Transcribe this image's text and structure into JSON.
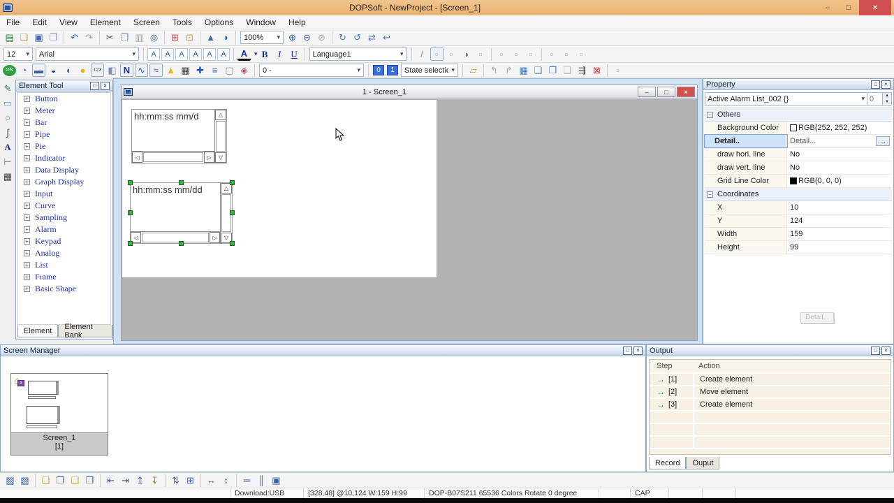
{
  "colors": {
    "titlebar": "#eab271",
    "close_button": "#d24f4f",
    "selection_handle": "#3cb043",
    "highlight_row": "#cfe3f8",
    "mdi_background": "#cfe0f0",
    "canvas_gray": "#b2b2b2",
    "bg_color_swatch": "#fcfcfc",
    "grid_line_swatch": "#000000"
  },
  "titlebar": {
    "title": "DOPSoft - NewProject - [Screen_1]"
  },
  "menu": {
    "items": [
      "File",
      "Edit",
      "View",
      "Element",
      "Screen",
      "Tools",
      "Options",
      "Window",
      "Help"
    ]
  },
  "toolbar1": {
    "zoom_value": "100%"
  },
  "toolbar2": {
    "font_size": "12",
    "font_name": "Arial",
    "language": "Language1",
    "bold": "B",
    "italic": "I",
    "underline": "U"
  },
  "toolbar3": {
    "address": "0 -",
    "state_off": "0",
    "state_on": "1",
    "state_select": "State selectio"
  },
  "element_tool": {
    "title": "Element Tool",
    "items": [
      "Button",
      "Meter",
      "Bar",
      "Pipe",
      "Pie",
      "Indicator",
      "Data Display",
      "Graph Display",
      "Input",
      "Curve",
      "Sampling",
      "Alarm",
      "Keypad",
      "Analog",
      "List",
      "Frame",
      "Basic Shape"
    ],
    "tab_element": "Element",
    "tab_element_bank": "Element Bank"
  },
  "canvas": {
    "window_title": "1 - Screen_1",
    "alarm_text_1": "hh:mm:ss  mm/d",
    "alarm_text_2": "hh:mm:ss  mm/dd"
  },
  "property": {
    "title": "Property",
    "element_selector": "Active Alarm List_002 {}",
    "spinner_value": "0",
    "section_others": "Others",
    "bg_color_label": "Background Color",
    "bg_color_value": "RGB(252, 252, 252)",
    "detail_label": "Detail..",
    "detail_value": "Detail...",
    "detail_more": "...",
    "hori_label": "draw hori. line",
    "hori_value": "No",
    "vert_label": "draw vert. line",
    "vert_value": "No",
    "grid_color_label": "Grid Line Color",
    "grid_color_value": "RGB(0, 0, 0)",
    "section_coordinates": "Coordinates",
    "x_label": "X",
    "x_value": "10",
    "y_label": "Y",
    "y_value": "124",
    "width_label": "Width",
    "width_value": "159",
    "height_label": "Height",
    "height_value": "99",
    "detail_button": "Detail..."
  },
  "screen_manager": {
    "title": "Screen Manager",
    "screen_name": "Screen_1",
    "screen_index": "[1]"
  },
  "output": {
    "title": "Output",
    "col_step": "Step",
    "col_action": "Action",
    "rows": [
      {
        "step": "[1]",
        "action": "Create element"
      },
      {
        "step": "[2]",
        "action": "Move element"
      },
      {
        "step": "[3]",
        "action": "Create element"
      }
    ],
    "tab_record": "Record",
    "tab_output": "Ouput"
  },
  "statusbar": {
    "download": "Download:USB",
    "coords": "[328,48] @10,124 W:159 H:99",
    "device": "DOP-B07S211 65536 Colors Rotate 0 degree",
    "caps": "CAP"
  },
  "icons": {
    "min": "–",
    "max": "□",
    "close": "×",
    "pmax": "□",
    "pclose": "×",
    "dd": "▾",
    "spin_up": "▲",
    "spin_dn": "▼",
    "plus": "+",
    "minus": "−",
    "s_up": "△",
    "s_dn": "▽",
    "s_lt": "◁",
    "s_rt": "▷",
    "home": "⌂",
    "home_n": "1",
    "step_arrow": "→",
    "new": "▤",
    "open": "❏",
    "save": "▣",
    "saveall": "❐",
    "undo": "↶",
    "redo": "↷",
    "cut": "✂",
    "copy": "❐",
    "paste": "▥",
    "find": "◎",
    "addscr": "⊞",
    "openscr": "⊡",
    "upload": "▲",
    "contrast": "◑",
    "zin": "⊕",
    "zout": "⊖",
    "znone": "⊘",
    "rotcw": "↻",
    "rotccw": "↺",
    "trans": "⇄",
    "undorot": "↩",
    "a": "A",
    "slash": "/",
    "box": "▫",
    "on": "ON",
    "meter": "◔",
    "bar": "▬",
    "tank": "◒",
    "half": "◖",
    "pie": "●",
    "numd": "123",
    "ind": "◧",
    "numi": "N",
    "curve": "∿",
    "graph": "≈",
    "keypad2": "▲",
    "kb": "▦",
    "pipe": "✚",
    "list": "≡",
    "frame": "▢",
    "shape": "◈",
    "macro": "▱",
    "prev": "↰",
    "next": "↱",
    "multi": "▦",
    "scr1": "❏",
    "scr2": "❐",
    "scr3": "❑",
    "build": "⇶",
    "dl": "⊠",
    "pencil": "✎",
    "rect": "▭",
    "ellipse": "○",
    "bezier": "∫",
    "textA": "A",
    "scale": "⊢",
    "table": "▦",
    "b1": "▧",
    "b2": "▨",
    "b3": "❏",
    "b4": "❐",
    "b5": "❑",
    "b6": "❒",
    "b7": "⇤",
    "b8": "⇥",
    "b9": "↥",
    "b10": "↧",
    "b11": "⇅",
    "b12": "⊞",
    "b13": "⊟",
    "b14": "↔",
    "b15": "↕",
    "b16": "═",
    "b17": "║",
    "b18": "▣"
  }
}
